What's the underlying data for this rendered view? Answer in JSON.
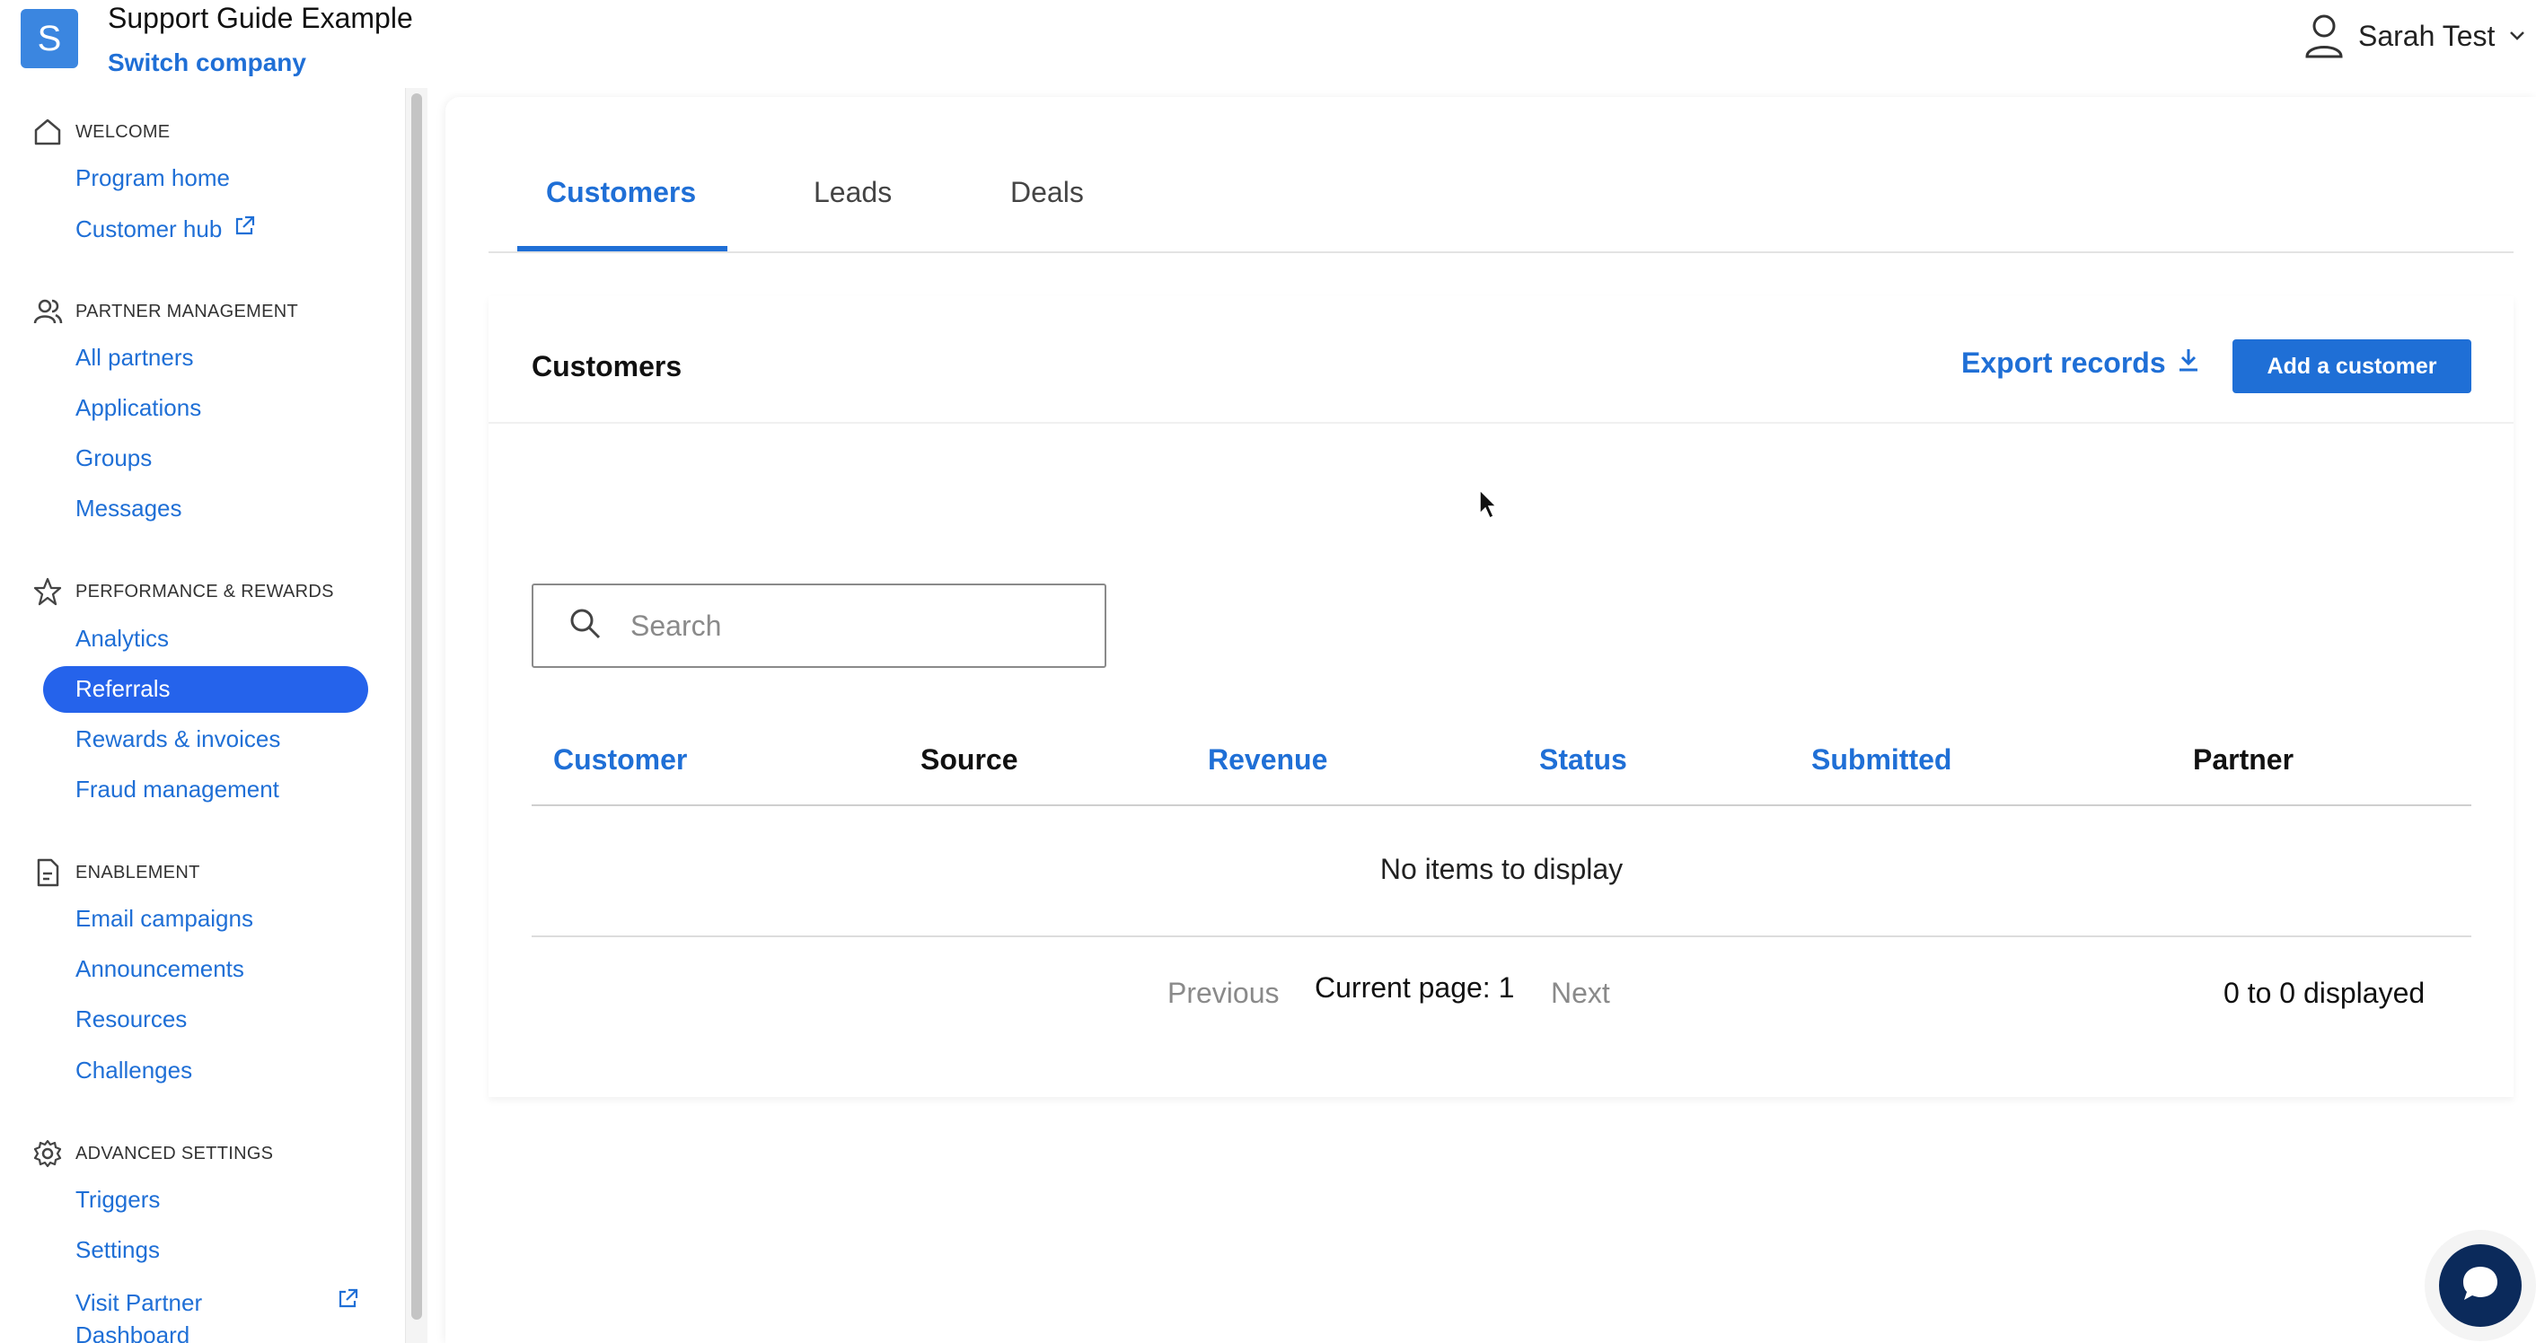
{
  "header": {
    "logo_letter": "S",
    "company_name": "Support Guide Example",
    "switch_company": "Switch company",
    "user_name": "Sarah Test"
  },
  "sidebar": {
    "sections": [
      {
        "title": "WELCOME",
        "icon": "home-icon",
        "items": [
          {
            "label": "Program home"
          },
          {
            "label": "Customer hub",
            "external": true
          }
        ]
      },
      {
        "title": "PARTNER MANAGEMENT",
        "icon": "people-icon",
        "items": [
          {
            "label": "All partners"
          },
          {
            "label": "Applications"
          },
          {
            "label": "Groups"
          },
          {
            "label": "Messages"
          }
        ]
      },
      {
        "title": "PERFORMANCE & REWARDS",
        "icon": "star-icon",
        "items": [
          {
            "label": "Analytics"
          },
          {
            "label": "Referrals",
            "active": true
          },
          {
            "label": "Rewards & invoices"
          },
          {
            "label": "Fraud management"
          }
        ]
      },
      {
        "title": "ENABLEMENT",
        "icon": "document-icon",
        "items": [
          {
            "label": "Email campaigns"
          },
          {
            "label": "Announcements"
          },
          {
            "label": "Resources"
          },
          {
            "label": "Challenges"
          }
        ]
      },
      {
        "title": "ADVANCED SETTINGS",
        "icon": "gear-icon",
        "items": [
          {
            "label": "Triggers"
          },
          {
            "label": "Settings"
          },
          {
            "label": "Visit Partner",
            "label_line2": "Dashboard",
            "external": true
          }
        ]
      }
    ]
  },
  "tabs": [
    {
      "label": "Customers",
      "active": true
    },
    {
      "label": "Leads"
    },
    {
      "label": "Deals"
    }
  ],
  "panel": {
    "title": "Customers",
    "export_label": "Export records",
    "add_button": "Add a customer",
    "search_placeholder": "Search"
  },
  "table": {
    "columns": [
      {
        "label": "Customer",
        "sortable": true
      },
      {
        "label": "Source",
        "sortable": false
      },
      {
        "label": "Revenue",
        "sortable": true
      },
      {
        "label": "Status",
        "sortable": true
      },
      {
        "label": "Submitted",
        "sortable": true
      },
      {
        "label": "Partner",
        "sortable": false
      }
    ],
    "empty_message": "No items to display"
  },
  "pagination": {
    "previous": "Previous",
    "current": "Current page: 1",
    "next": "Next",
    "count": "0 to 0 displayed"
  },
  "colors": {
    "accent": "#1f6fd6",
    "active_nav": "#2563eb",
    "chat": "#0b2a5b"
  }
}
